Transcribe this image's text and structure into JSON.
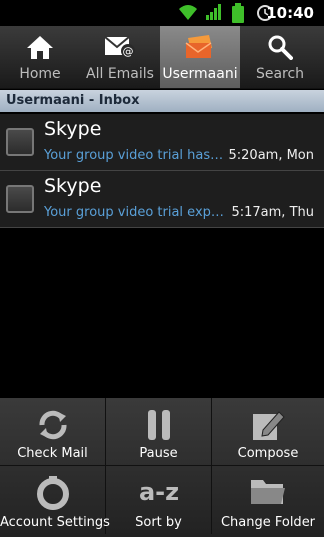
{
  "status_bar": {
    "time": "10:40"
  },
  "tabs": [
    {
      "label": "Home",
      "icon": "home-icon"
    },
    {
      "label": "All Emails",
      "icon": "all-emails-icon"
    },
    {
      "label": "Usermaani",
      "icon": "account-mail-icon",
      "active": true
    },
    {
      "label": "Search",
      "icon": "search-icon"
    }
  ],
  "folder_header": "Usermaani - Inbox",
  "emails": [
    {
      "sender": "Skype",
      "subject": "Your group video trial has e...",
      "date": "5:20am, Mon"
    },
    {
      "sender": "Skype",
      "subject": "Your group video trial expire...",
      "date": "5:17am, Thu"
    }
  ],
  "menu": [
    {
      "label": "Check Mail",
      "icon": "refresh-icon"
    },
    {
      "label": "Pause",
      "icon": "pause-icon"
    },
    {
      "label": "Compose",
      "icon": "compose-icon"
    },
    {
      "label": "Account Settings",
      "icon": "settings-icon"
    },
    {
      "label": "Sort by",
      "icon": "sort-az-icon"
    },
    {
      "label": "Change Folder",
      "icon": "folder-icon"
    }
  ],
  "colors": {
    "accent": "#5aa0d8",
    "tab_active": "#7a7a7a",
    "header": "#b5c2d0"
  }
}
